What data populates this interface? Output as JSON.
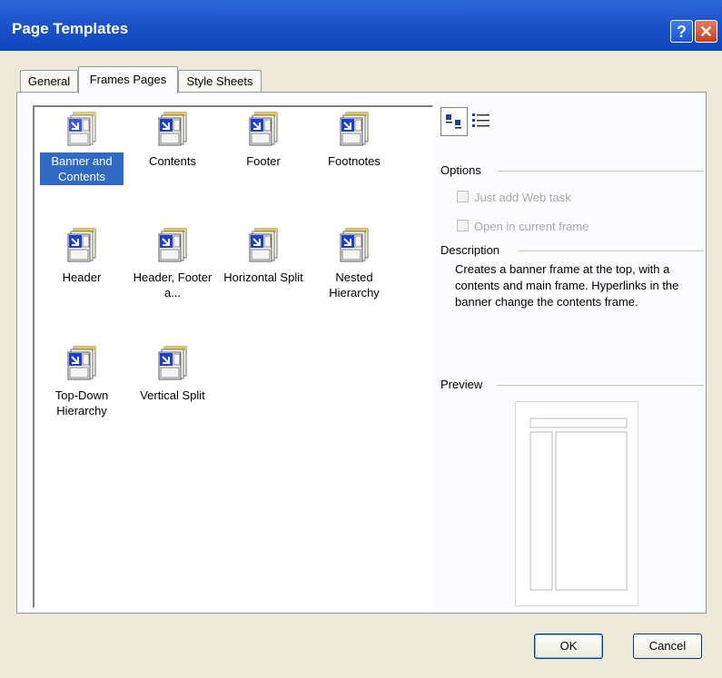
{
  "window": {
    "title": "Page Templates",
    "help_glyph": "?",
    "close_glyph": "✕"
  },
  "tabs": [
    {
      "label": "General"
    },
    {
      "label": "Frames Pages"
    },
    {
      "label": "Style Sheets"
    }
  ],
  "templates": [
    {
      "label": "Banner and Contents",
      "selected": true
    },
    {
      "label": "Contents"
    },
    {
      "label": "Footer"
    },
    {
      "label": "Footnotes"
    },
    {
      "label": "Header"
    },
    {
      "label": "Header, Footer a..."
    },
    {
      "label": "Horizontal Split"
    },
    {
      "label": "Nested Hierarchy"
    },
    {
      "label": "Top-Down Hierarchy"
    },
    {
      "label": "Vertical Split"
    }
  ],
  "options": {
    "heading": "Options",
    "just_add_web_task": "Just add Web task",
    "open_in_current_frame": "Open in current frame"
  },
  "description": {
    "heading": "Description",
    "text": "Creates a banner frame at the top, with a contents and main frame. Hyperlinks in the banner change the contents frame."
  },
  "preview": {
    "heading": "Preview"
  },
  "buttons": {
    "ok": "OK",
    "cancel": "Cancel"
  },
  "colors": {
    "titlebar": "#0c40b4",
    "selection": "#316ac5",
    "dialog_bg": "#ece9d8"
  }
}
